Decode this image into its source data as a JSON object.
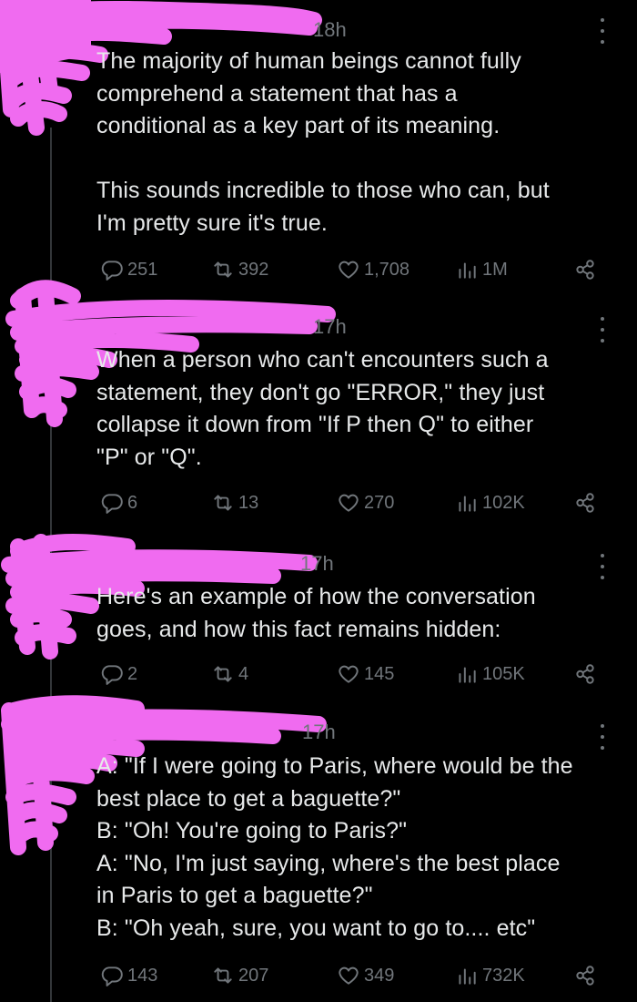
{
  "tweets": [
    {
      "time": "18h",
      "text": "The majority of human beings cannot fully\ncomprehend a statement that has a\nconditional as a key part of its meaning.\n\nThis sounds incredible to those who can, but\nI'm pretty sure it's true.",
      "replies": "251",
      "retweets": "392",
      "likes": "1,708",
      "views": "1M"
    },
    {
      "time": "17h",
      "text": "When a person who can't encounters such a\nstatement, they don't go \"ERROR,\" they just\ncollapse it down from \"If P then Q\" to either\n\"P\" or \"Q\".",
      "replies": "6",
      "retweets": "13",
      "likes": "270",
      "views": "102K"
    },
    {
      "time": "17h",
      "text": "Here's an example of how the conversation\ngoes, and how this fact remains hidden:",
      "replies": "2",
      "retweets": "4",
      "likes": "145",
      "views": "105K"
    },
    {
      "time": "17h",
      "text": "A: \"If I were going to Paris, where would be the\nbest place to get a baguette?\"\nB: \"Oh!  You're going to Paris?\"\nA: \"No, I'm just saying, where's the best place\nin Paris to get a baguette?\"\nB: \"Oh yeah, sure, you want to go to.... etc\"",
      "replies": "143",
      "retweets": "207",
      "likes": "349",
      "views": "732K"
    }
  ],
  "icons": {
    "reply": "reply-icon",
    "retweet": "retweet-icon",
    "like": "like-icon",
    "views": "views-icon",
    "share": "share-icon",
    "more": "more-icon"
  },
  "colors": {
    "background": "#000000",
    "text": "#e7e9ea",
    "muted": "#71767b",
    "redaction": "#f06bf0"
  }
}
